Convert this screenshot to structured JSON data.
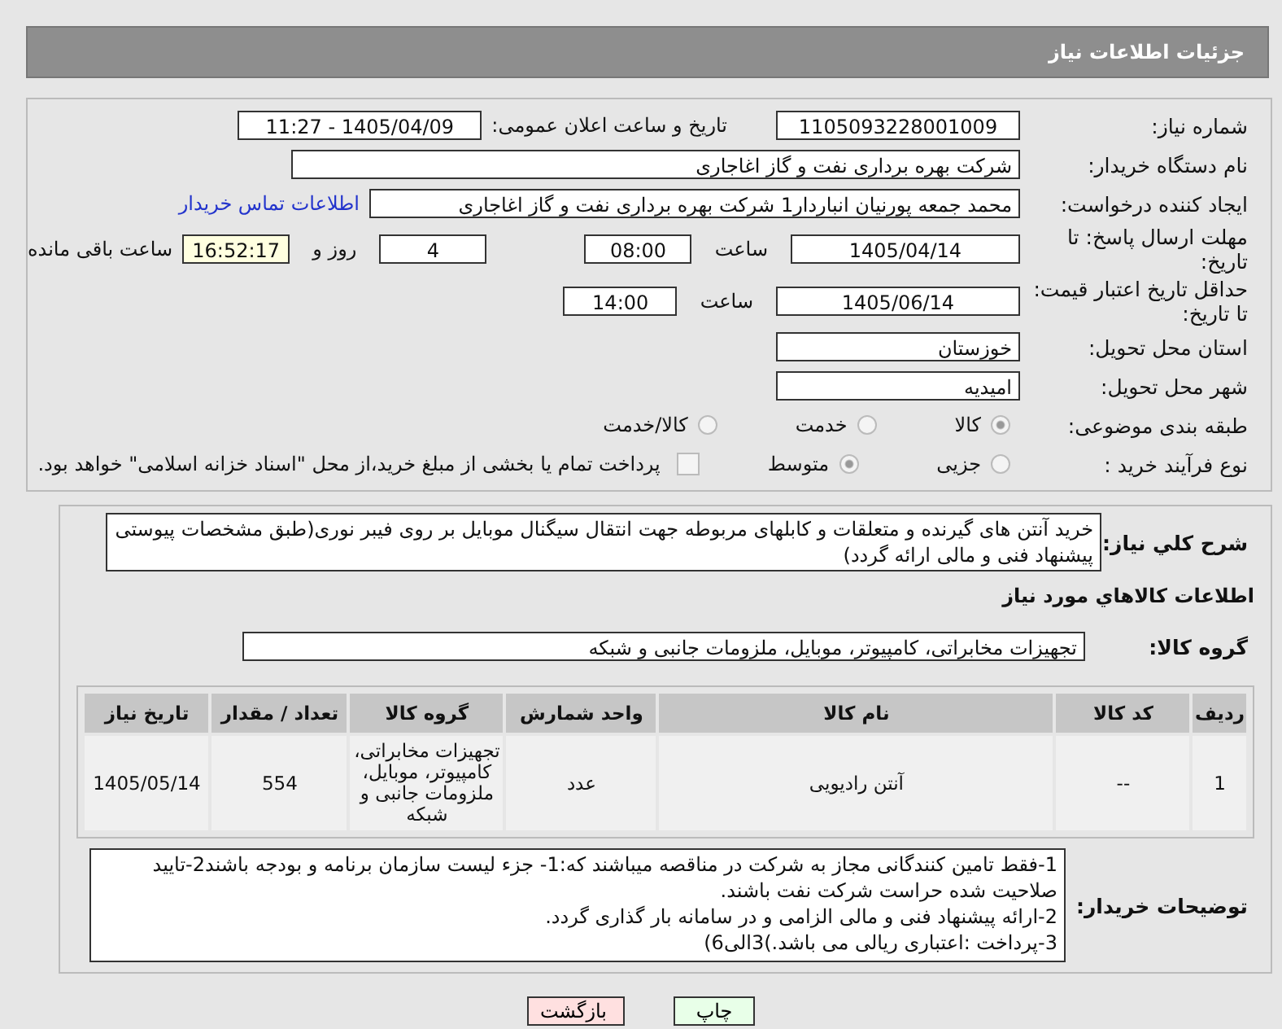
{
  "header": {
    "title": "جزئیات اطلاعات نیاز"
  },
  "need_number": {
    "label": "شماره نیاز:",
    "value": "1105093228001009"
  },
  "announce": {
    "label": "تاریخ و ساعت اعلان عمومی:",
    "value": "1405/04/09 - 11:27"
  },
  "buyer_org": {
    "label": "نام دستگاه خریدار:",
    "value": "شرکت بهره برداری نفت و گاز اغاجاری"
  },
  "creator": {
    "label": "ایجاد کننده درخواست:",
    "value": "محمد جمعه پورنیان انباردار1 شرکت بهره برداری نفت و گاز اغاجاری",
    "link": "اطلاعات تماس خریدار"
  },
  "deadline": {
    "label": "مهلت ارسال پاسخ: تا تاریخ:",
    "date": "1405/04/14",
    "time_label": "ساعت",
    "time": "08:00",
    "days": "4",
    "days_label": "روز و",
    "remaining": "16:52:17",
    "remaining_label": "ساعت باقی مانده"
  },
  "validity": {
    "label": "حداقل تاریخ اعتبار قیمت: تا تاریخ:",
    "date": "1405/06/14",
    "time_label": "ساعت",
    "time": "14:00"
  },
  "province": {
    "label": "استان محل تحویل:",
    "value": "خوزستان"
  },
  "city": {
    "label": "شهر محل تحویل:",
    "value": "امیدیه"
  },
  "category": {
    "label": "طبقه بندی موضوعی:",
    "options": [
      {
        "label": "کالا",
        "selected": true
      },
      {
        "label": "خدمت",
        "selected": false
      },
      {
        "label": "کالا/خدمت",
        "selected": false
      }
    ]
  },
  "process": {
    "label": "نوع فرآیند خرید :",
    "options": [
      {
        "label": "جزیی",
        "selected": false
      },
      {
        "label": "متوسط",
        "selected": true
      }
    ],
    "payment": {
      "label": "پرداخت تمام یا بخشی از مبلغ خرید،از محل \"اسناد خزانه اسلامی\" خواهد بود.",
      "checked": false
    }
  },
  "summary": {
    "label": "شرح کلي نیاز:",
    "value": "خرید آنتن های گیرنده و متعلقات و کابلهای مربوطه جهت انتقال سیگنال موبایل بر روی فیبر نوری(طبق مشخصات پیوستی پیشنهاد فنی و مالی ارائه گردد)"
  },
  "goods_title": "اطلاعات کالاهاي مورد نیاز",
  "goods_group": {
    "label": "گروه کالا:",
    "value": "تجهیزات مخابراتی، کامپیوتر، موبایل، ملزومات جانبی و شبکه"
  },
  "table": {
    "columns": [
      "ردیف",
      "کد کالا",
      "نام کالا",
      "واحد شمارش",
      "گروه کالا",
      "تعداد / مقدار",
      "تاریخ نیاز"
    ],
    "rows": [
      [
        "1",
        "--",
        "آنتن رادیویی",
        "عدد",
        "تجهیزات مخابراتی، کامپیوتر، موبایل، ملزومات جانبی و شبکه",
        "554",
        "1405/05/14"
      ]
    ]
  },
  "notes": {
    "label": "توضیحات خریدار:",
    "lines": [
      "1-فقط تامین کنندگانی مجاز به شرکت در مناقصه میباشند که:1- جزء لیست سازمان برنامه و بودجه باشند2-تایید صلاحیت شده حراست شرکت نفت باشند.",
      "2-ارائه پیشنهاد فنی و مالی الزامی و در سامانه بار گذاری گردد.",
      "3-پرداخت :اعتباری ریالی  می باشد.)3الی6)"
    ]
  },
  "buttons": [
    {
      "label": "چاپ",
      "kind": "print"
    },
    {
      "label": "بازگشت",
      "kind": "back"
    }
  ]
}
